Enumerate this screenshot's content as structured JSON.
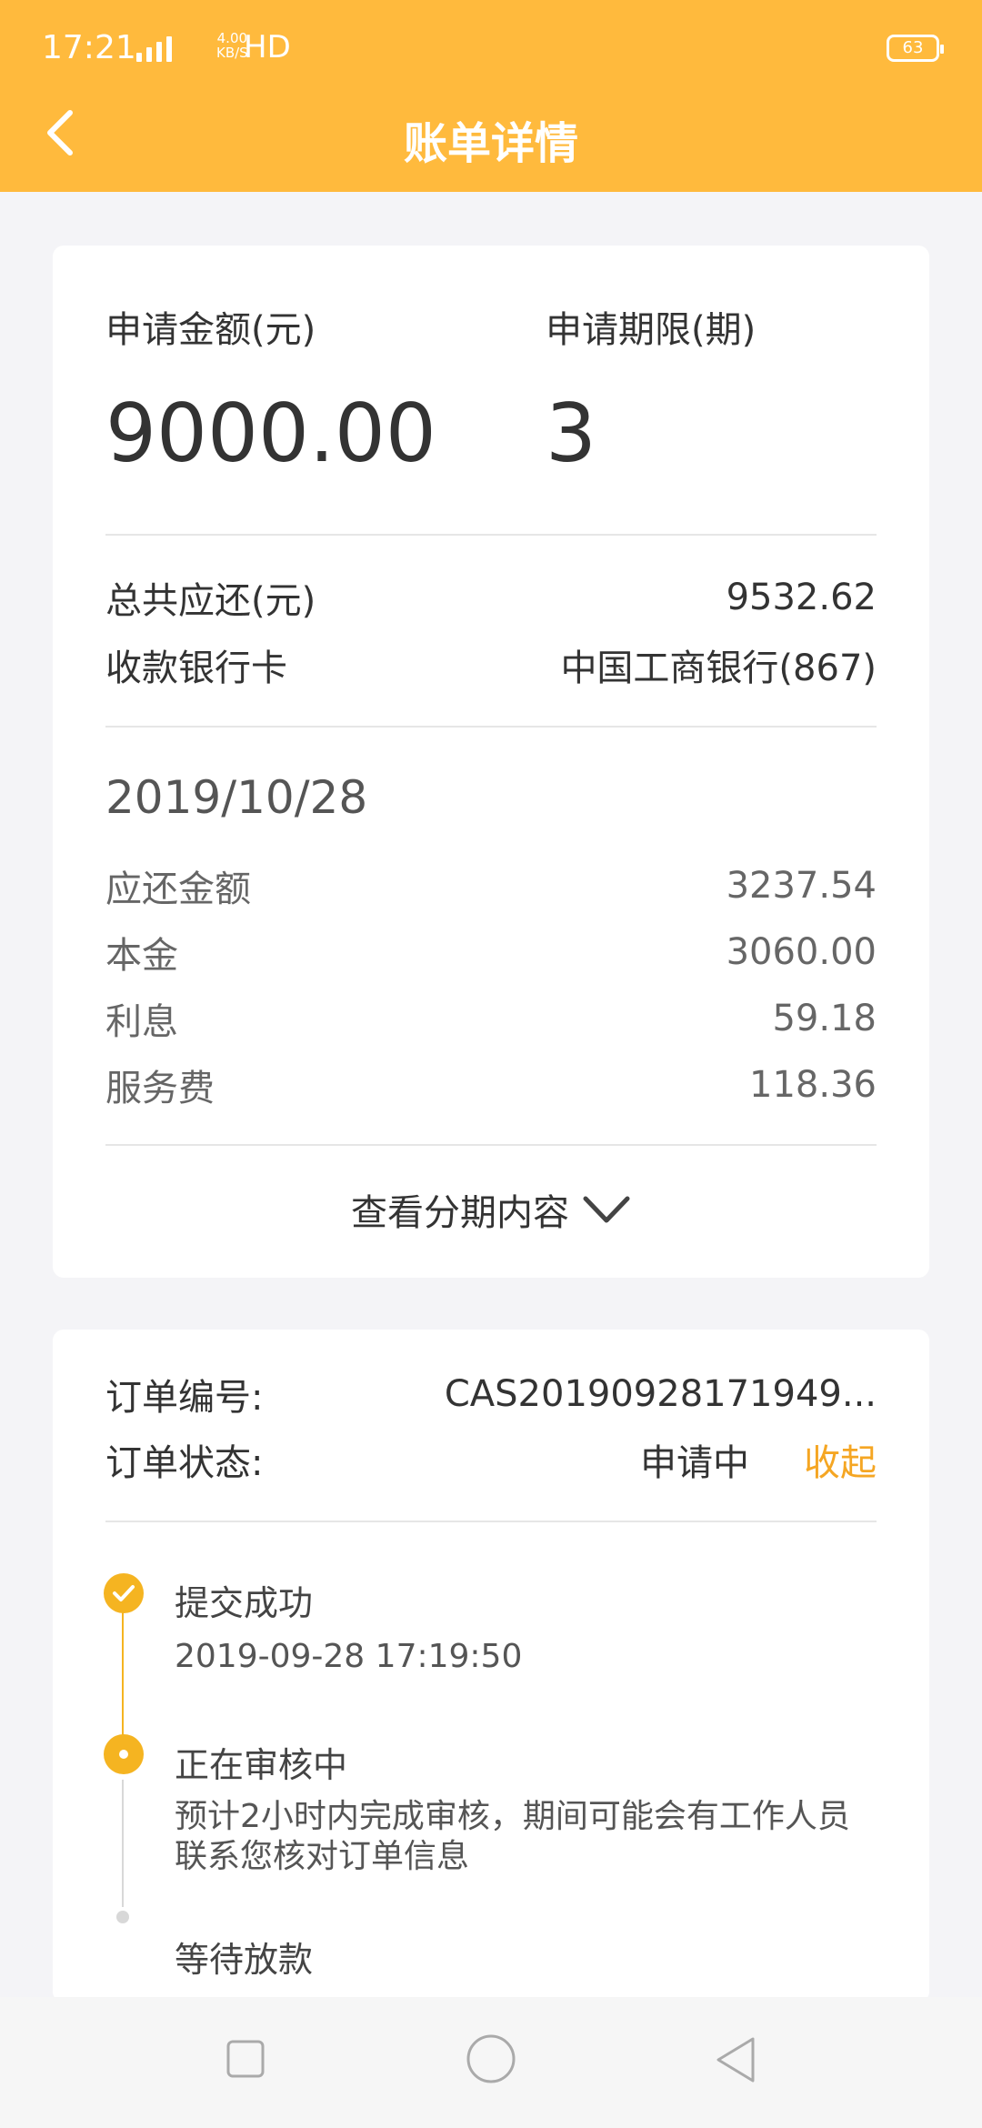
{
  "status_bar": {
    "time": "17:21",
    "network": "4G",
    "speed": "4.00",
    "speed_unit": "KB/S",
    "hd": "HD",
    "battery": "63"
  },
  "header": {
    "title": "账单详情",
    "back_icon": "chevron-left-icon"
  },
  "summary": {
    "amount_label": "申请金额(元)",
    "amount_value": "9000.00",
    "term_label": "申请期限(期)",
    "term_value": "3",
    "total_label": "总共应还(元)",
    "total_value": "9532.62",
    "card_label": "收款银行卡",
    "card_value": "中国工商银行(867)"
  },
  "installment": {
    "date": "2019/10/28",
    "rows": [
      {
        "label": "应还金额",
        "value": "3237.54"
      },
      {
        "label": "本金",
        "value": "3060.00"
      },
      {
        "label": "利息",
        "value": "59.18"
      },
      {
        "label": "服务费",
        "value": "118.36"
      }
    ],
    "toggle_label": "查看分期内容"
  },
  "order": {
    "number_label": "订单编号:",
    "number_value": "CAS20190928171949...",
    "status_label": "订单状态:",
    "status_value": "申请中",
    "collapse_label": "收起"
  },
  "timeline": [
    {
      "title": "提交成功",
      "subtitle": "2019-09-28 17:19:50",
      "state": "done"
    },
    {
      "title": "正在审核中",
      "subtitle_lines": [
        "预计2小时内完成审核，期间可能会有工作人员",
        "联系您核对订单信息"
      ],
      "state": "current"
    },
    {
      "title": "等待放款",
      "state": "pending"
    }
  ],
  "colors": {
    "accent": "#ffba3d",
    "accent_text": "#f5a623",
    "background": "#f4f4f7"
  }
}
